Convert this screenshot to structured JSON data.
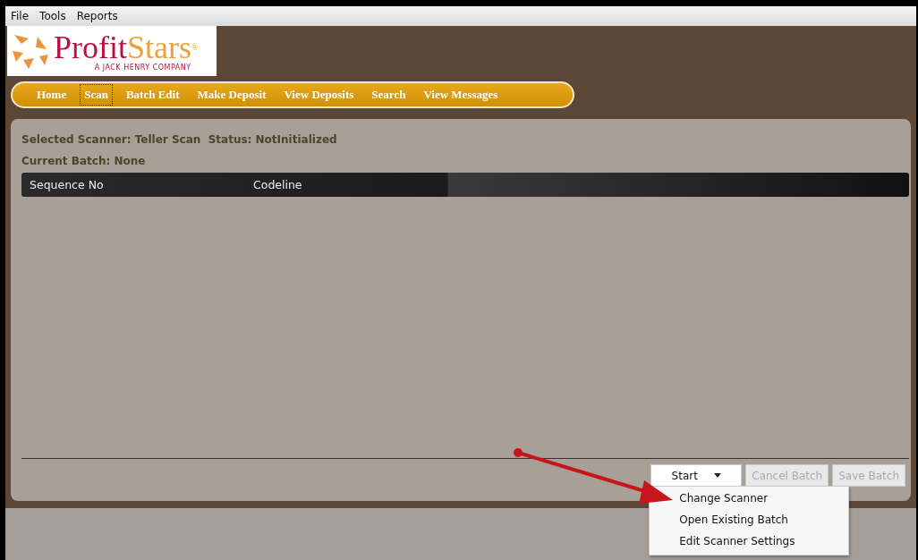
{
  "menu_bar": [
    "File",
    "Tools",
    "Reports"
  ],
  "logo": {
    "name": "Profit",
    "name_accent": "Stars",
    "mark": "®",
    "tagline": "A JACK HENRY COMPANY"
  },
  "nav": [
    {
      "label": "Home",
      "selected": false
    },
    {
      "label": "Scan",
      "selected": true
    },
    {
      "label": "Batch Edit",
      "selected": false
    },
    {
      "label": "Make Deposit",
      "selected": false
    },
    {
      "label": "View Deposits",
      "selected": false
    },
    {
      "label": "Search",
      "selected": false
    },
    {
      "label": "View Messages",
      "selected": false
    }
  ],
  "status_lines": [
    "Selected Scanner: Teller Scan  Status: NotInitialized",
    "Current Batch: None"
  ],
  "table": {
    "columns": [
      "Sequence No",
      "Codeline"
    ]
  },
  "buttons": [
    {
      "label": "Start",
      "kind": "dropdown",
      "disabled": false
    },
    {
      "label": "Cancel Batch",
      "kind": "button",
      "disabled": true
    },
    {
      "label": "Save Batch",
      "kind": "button",
      "disabled": true
    }
  ],
  "dropdown_menu": [
    "Change Scanner",
    "Open Existing Batch",
    "Edit Scanner Settings"
  ]
}
